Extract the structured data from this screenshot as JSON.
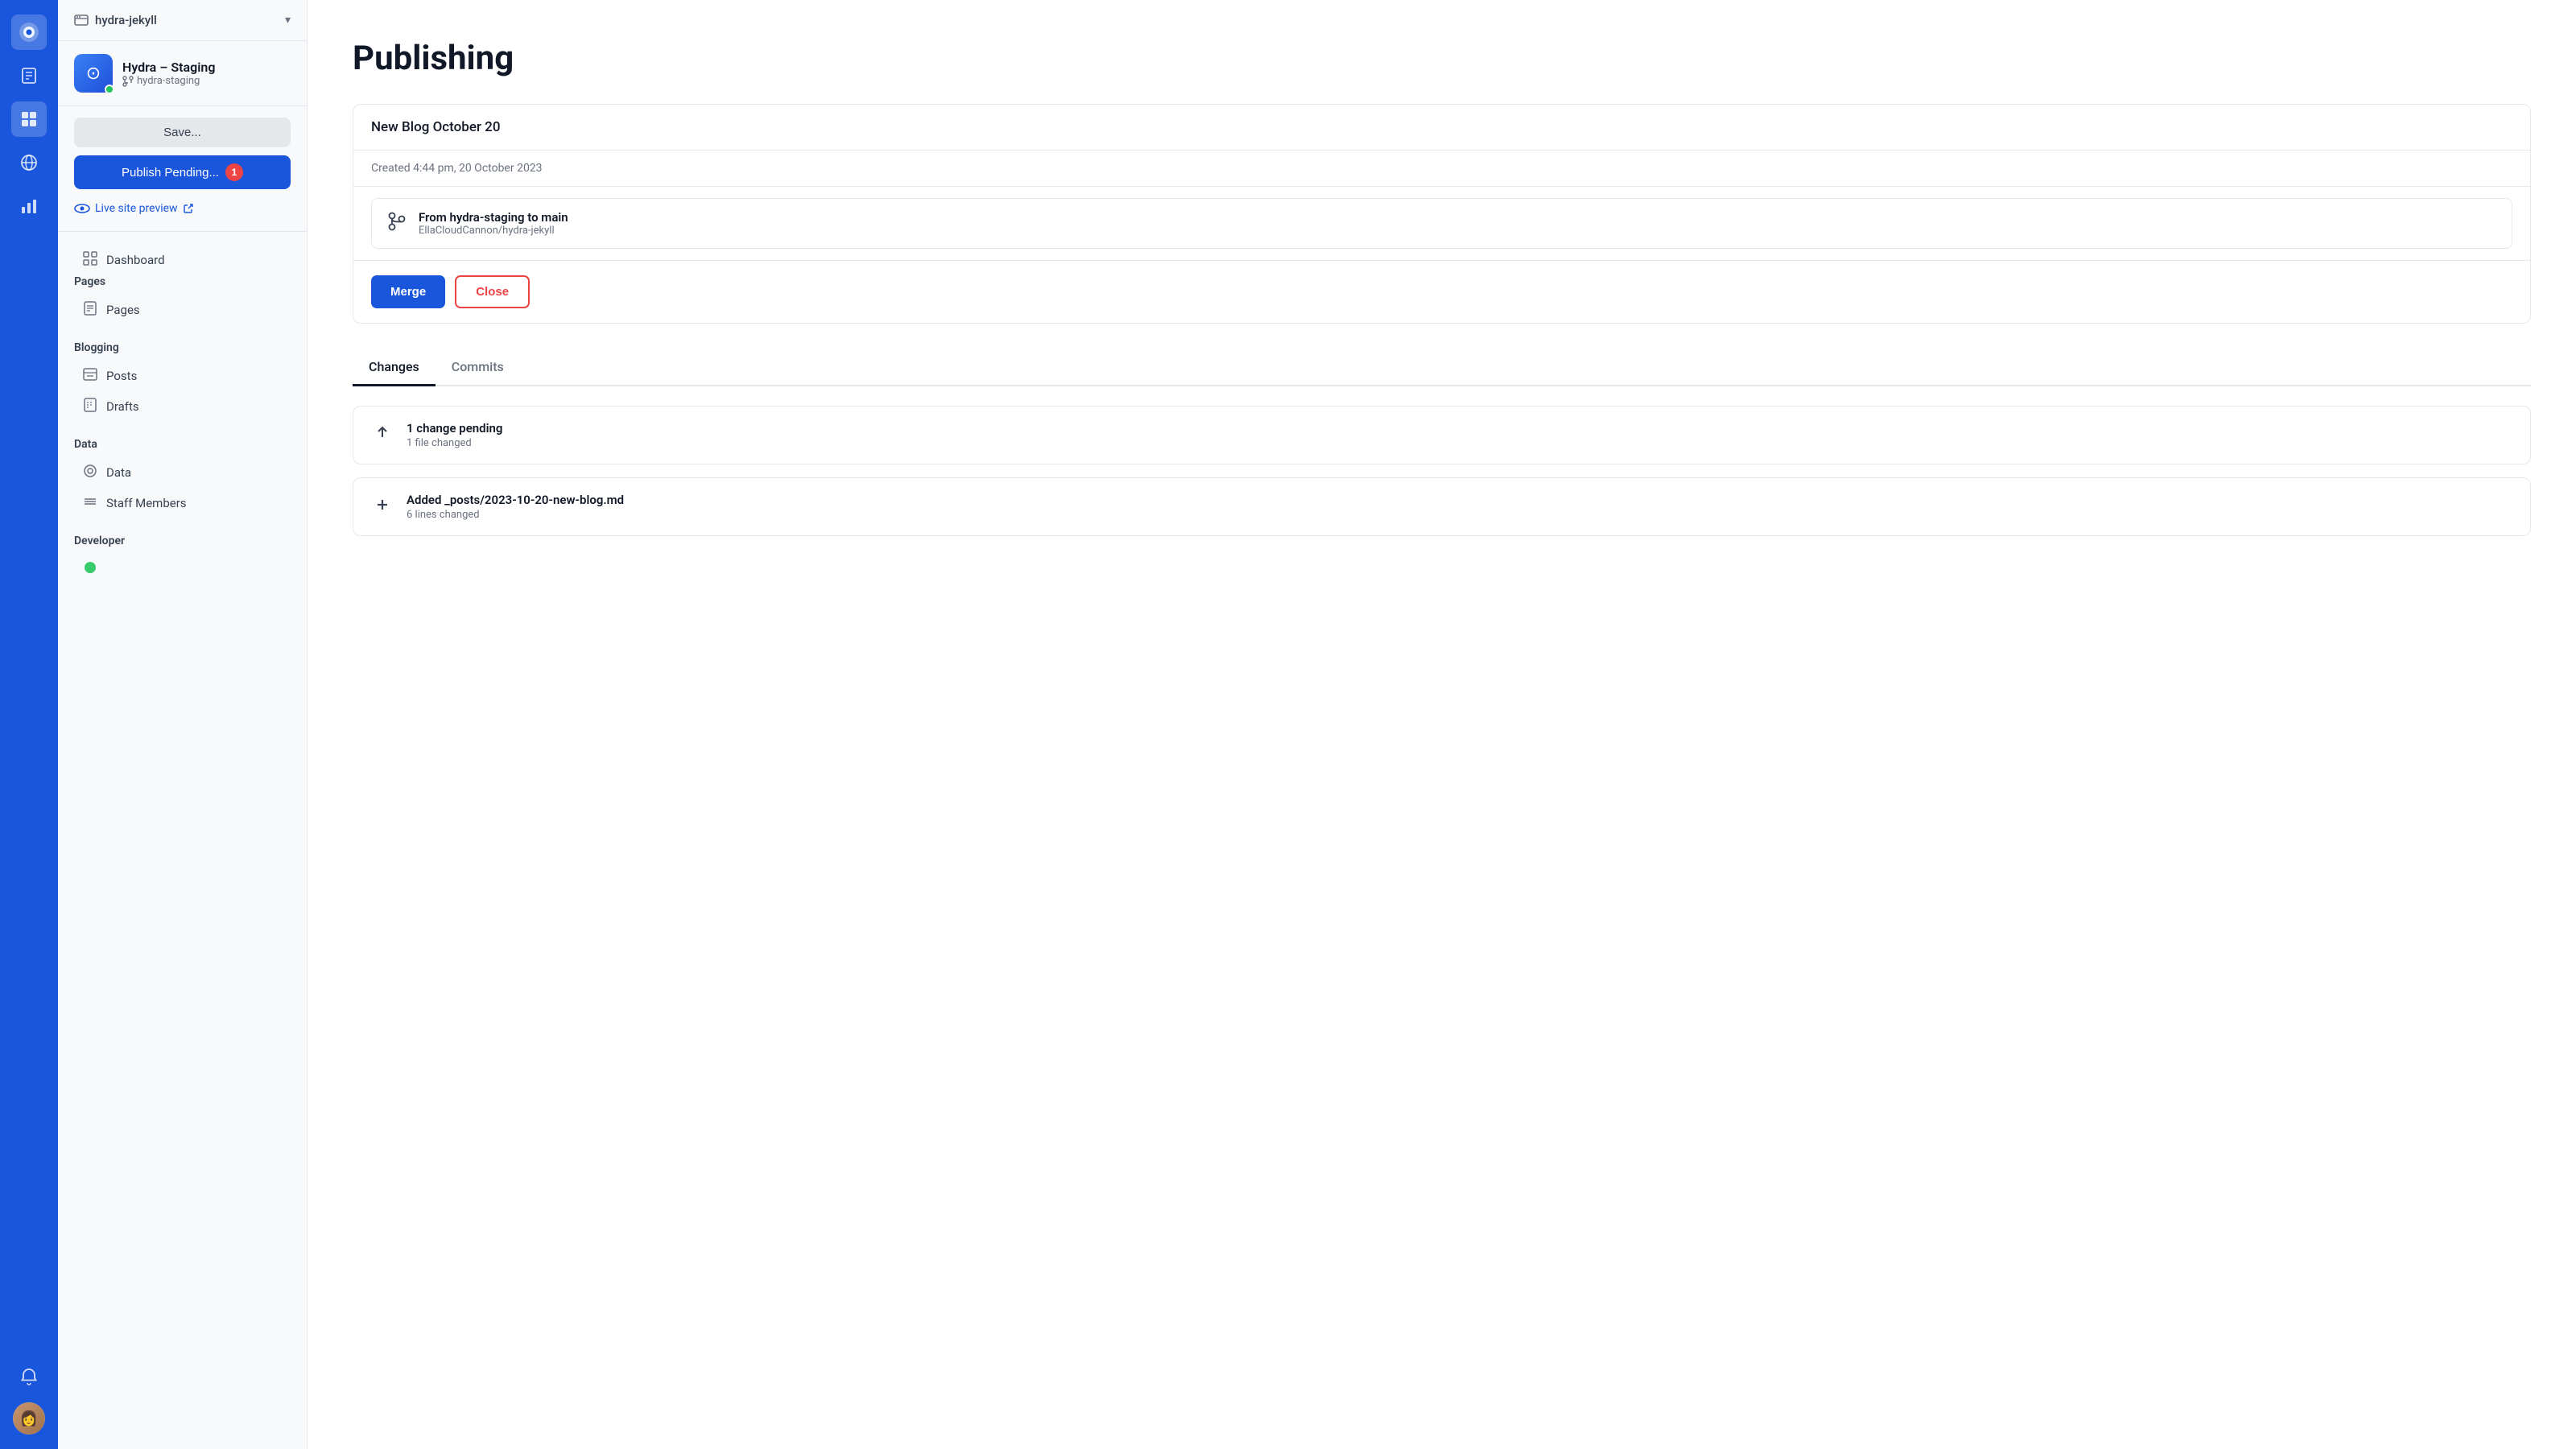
{
  "site_selector": {
    "icon": "⊡",
    "name": "hydra-jekyll",
    "chevron": "▾"
  },
  "site_card": {
    "name": "Hydra – Staging",
    "branch": "hydra-staging",
    "branch_icon": "⇄"
  },
  "actions": {
    "save_label": "Save...",
    "publish_label": "Publish Pending...",
    "publish_badge": "1",
    "live_preview_label": "Live site preview"
  },
  "nav": {
    "dashboard": "Dashboard",
    "pages_section": "Pages",
    "pages_item": "Pages",
    "blogging_section": "Blogging",
    "posts_item": "Posts",
    "drafts_item": "Drafts",
    "data_section": "Data",
    "data_item": "Data",
    "staff_members_item": "Staff Members",
    "developer_section": "Developer"
  },
  "page": {
    "title": "Publishing"
  },
  "pr_card": {
    "title": "New Blog October 20",
    "created_at": "Created 4:44 pm, 20 October 2023",
    "branch_from": "From hydra-staging to main",
    "repo": "EllaCloudCannon/hydra-jekyll",
    "merge_label": "Merge",
    "close_label": "Close"
  },
  "tabs": [
    {
      "label": "Changes",
      "active": true
    },
    {
      "label": "Commits",
      "active": false
    }
  ],
  "changes": [
    {
      "icon": "↑",
      "title": "1 change pending",
      "meta": "1 file changed"
    },
    {
      "icon": "+",
      "title": "Added _posts/2023-10-20-new-blog.md",
      "meta": "6 lines changed"
    }
  ]
}
